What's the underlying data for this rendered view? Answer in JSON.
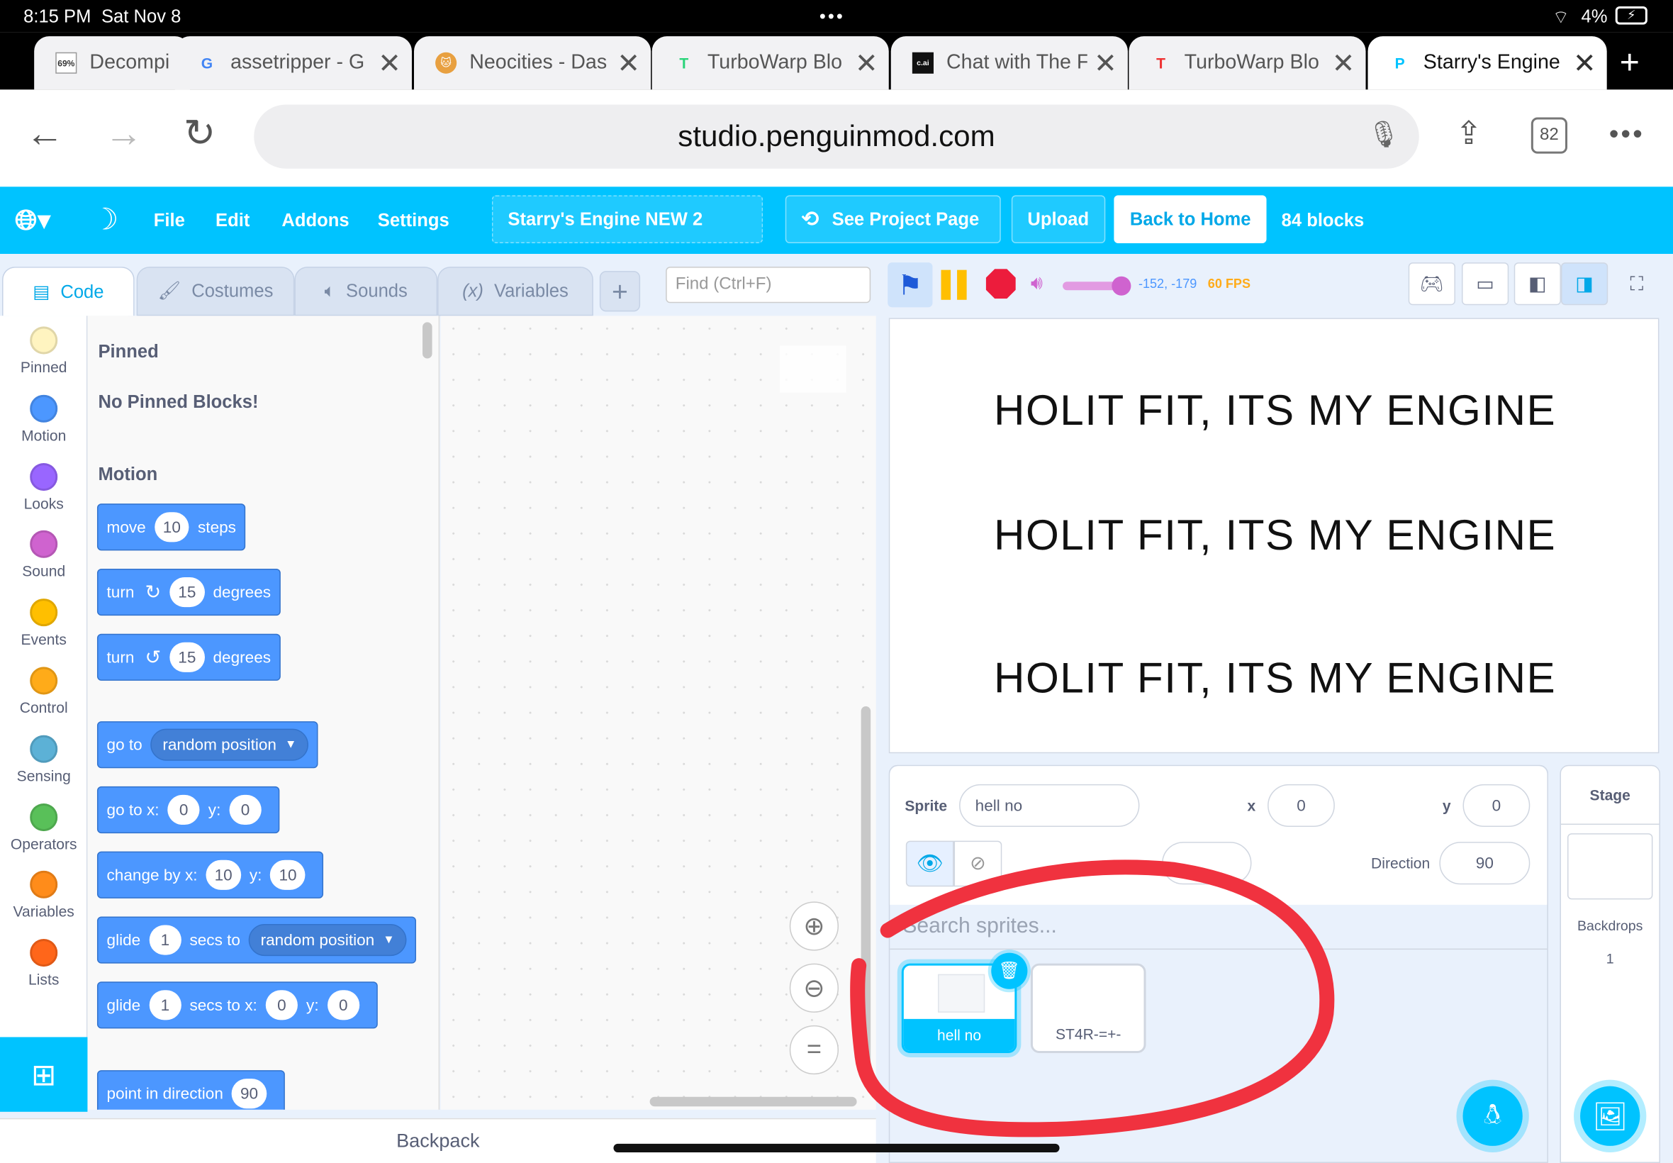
{
  "status": {
    "time": "8:15 PM",
    "date": "Sat Nov 8",
    "battery": "4%"
  },
  "tabs": [
    {
      "label": "Decompi",
      "favicon": "69%"
    },
    {
      "label": "assetripper - G",
      "favicon": "G"
    },
    {
      "label": "Neocities - Das",
      "favicon": "cat"
    },
    {
      "label": "TurboWarp Blo",
      "favicon": "T"
    },
    {
      "label": "Chat with The F",
      "favicon": "c.ai"
    },
    {
      "label": "TurboWarp Blo",
      "favicon": "T"
    },
    {
      "label": "Starry's Engine",
      "favicon": "P"
    }
  ],
  "address": {
    "url": "studio.penguinmod.com",
    "tab_count": "82"
  },
  "menu": {
    "file": "File",
    "edit": "Edit",
    "addons": "Addons",
    "settings": "Settings",
    "project_title": "Starry's Engine NEW 2",
    "see_project": "See Project Page",
    "upload": "Upload",
    "back_home": "Back to Home",
    "block_count": "84 blocks"
  },
  "editor_tabs": {
    "code": "Code",
    "costumes": "Costumes",
    "sounds": "Sounds",
    "variables": "Variables"
  },
  "find": {
    "placeholder": "Find (Ctrl+F)"
  },
  "stage_controls": {
    "coords": "-152, -179",
    "fps": "60 FPS"
  },
  "categories": [
    {
      "label": "Pinned",
      "color": "#fff4c0"
    },
    {
      "label": "Motion",
      "color": "#4c97ff"
    },
    {
      "label": "Looks",
      "color": "#9966ff"
    },
    {
      "label": "Sound",
      "color": "#cf63cf"
    },
    {
      "label": "Events",
      "color": "#ffbf00"
    },
    {
      "label": "Control",
      "color": "#ffab19"
    },
    {
      "label": "Sensing",
      "color": "#5cb1d6"
    },
    {
      "label": "Operators",
      "color": "#59c059"
    },
    {
      "label": "Variables",
      "color": "#ff8c1a"
    },
    {
      "label": "Lists",
      "color": "#ff661a"
    }
  ],
  "flyout": {
    "pinned_header": "Pinned",
    "no_pinned": "No Pinned Blocks!",
    "motion_header": "Motion",
    "b_move": {
      "a": "move",
      "n": "10",
      "b": "steps"
    },
    "b_turn_cw": {
      "a": "turn",
      "n": "15",
      "b": "degrees"
    },
    "b_turn_ccw": {
      "a": "turn",
      "n": "15",
      "b": "degrees"
    },
    "b_goto": {
      "a": "go to",
      "d": "random position"
    },
    "b_gotoxy": {
      "a": "go to x:",
      "x": "0",
      "y_lbl": "y:",
      "y": "0"
    },
    "b_change": {
      "a": "change by x:",
      "x": "10",
      "y_lbl": "y:",
      "y": "10"
    },
    "b_glide1": {
      "a": "glide",
      "n": "1",
      "b": "secs to",
      "d": "random position"
    },
    "b_glide2": {
      "a": "glide",
      "n": "1",
      "b": "secs to x:",
      "x": "0",
      "y_lbl": "y:",
      "y": "0"
    },
    "b_point": {
      "a": "point in direction",
      "n": "90"
    }
  },
  "backpack": "Backpack",
  "stage_lines": [
    "HOLIT FIT, ITS MY ENGINE",
    "HOLIT FIT, ITS MY ENGINE",
    "HOLIT FIT, ITS MY ENGINE"
  ],
  "sprite_info": {
    "sprite_label": "Sprite",
    "sprite_name": "hell no",
    "x_label": "x",
    "x": "0",
    "y_label": "y",
    "y": "0",
    "direction_label": "Direction",
    "direction": "90"
  },
  "sprite_search": {
    "placeholder": "Search sprites..."
  },
  "sprites": [
    {
      "name": "hell no"
    },
    {
      "name": "ST4R-=+-"
    }
  ],
  "stage_pane": {
    "title": "Stage",
    "backdrops_label": "Backdrops",
    "backdrops_count": "1"
  },
  "annotation_color": "#f0323f"
}
